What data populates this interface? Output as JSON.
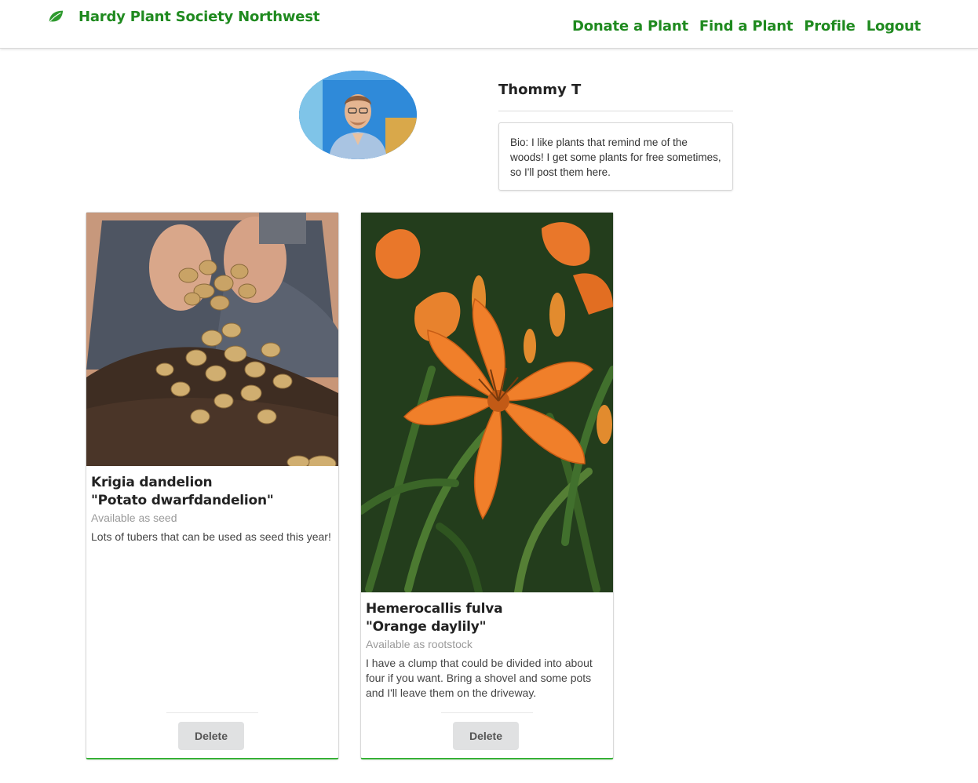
{
  "app": {
    "brand": "Hardy Plant Society Northwest",
    "colors": {
      "accent": "#1f8a1f",
      "card_border_bottom": "#36b036"
    },
    "icon": "leaf-icon"
  },
  "nav": {
    "items": [
      {
        "label": "Donate a Plant"
      },
      {
        "label": "Find a Plant"
      },
      {
        "label": "Profile"
      },
      {
        "label": "Logout"
      }
    ]
  },
  "profile": {
    "name": "Thommy T",
    "bio": "Bio: I like plants that remind me of the woods! I get some plants for free sometimes, so I'll post them here."
  },
  "plants": [
    {
      "title_line1": "Krigia dandelion",
      "title_line2": "\"Potato dwarfdandelion\"",
      "availability": "Available as seed",
      "description": "Lots of tubers that can be used as seed this year!",
      "action": "Delete"
    },
    {
      "title_line1": "Hemerocallis fulva",
      "title_line2": "\"Orange daylily\"",
      "availability": "Available as rootstock",
      "description": "I have a clump that could be divided into about four if you want. Bring a shovel and some pots and I'll leave them on the driveway.",
      "action": "Delete"
    }
  ]
}
